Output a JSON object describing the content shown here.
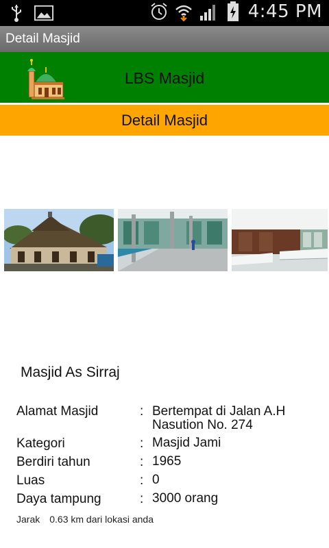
{
  "status_bar": {
    "time": "4:45 PM",
    "icons": [
      "usb-icon",
      "image-icon",
      "alarm-icon",
      "wifi-icon",
      "signal-icon",
      "battery-charging-icon"
    ]
  },
  "title_bar": {
    "title": "Detail Masjid"
  },
  "header": {
    "title": "LBS Masjid",
    "logo": "mosque-logo-icon",
    "background": "#008000"
  },
  "section": {
    "title": "Detail Masjid",
    "background": "#ffa500"
  },
  "gallery": {
    "images": [
      "mosque-exterior-photo",
      "mosque-veranda-photo",
      "mosque-interior-photo"
    ]
  },
  "mosque": {
    "name": "Masjid As Sirraj",
    "fields": [
      {
        "label": "Alamat Masjid",
        "value": "Bertempat di Jalan A.H Nasution No. 274"
      },
      {
        "label": "Kategori",
        "value": "Masjid Jami"
      },
      {
        "label": "Berdiri tahun",
        "value": "1965"
      },
      {
        "label": "Luas",
        "value": "0"
      },
      {
        "label": "Daya tampung",
        "value": "3000 orang"
      }
    ],
    "separator": ":",
    "distance_label": "Jarak",
    "distance_value": "0.63 km dari lokasi anda"
  }
}
